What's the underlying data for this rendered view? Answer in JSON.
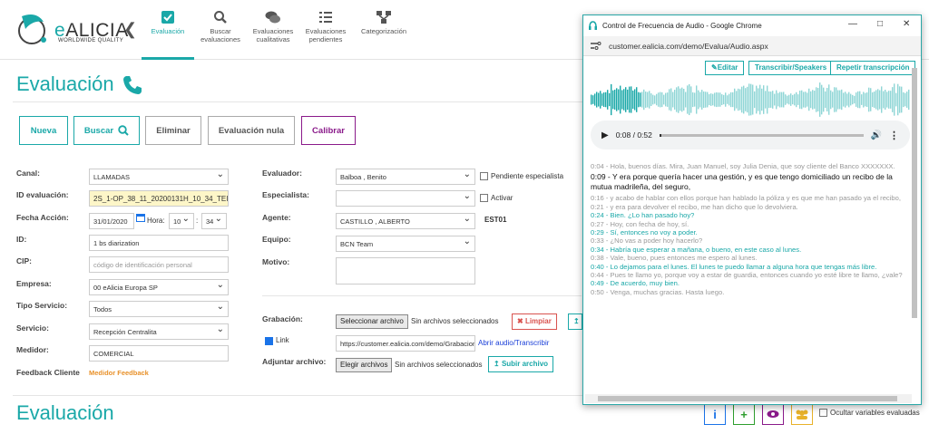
{
  "brand": {
    "name_e": "e",
    "name_rest": "ALICIA",
    "sub": "WORLDWIDE QUALITY"
  },
  "nav": [
    {
      "label": "Evaluación",
      "icon": "checkbox-icon"
    },
    {
      "label": "Buscar evaluaciones",
      "icon": "search-icon"
    },
    {
      "label": "Evaluaciones cualitativas",
      "icon": "comments-icon"
    },
    {
      "label": "Evaluaciones pendientes",
      "icon": "list-icon"
    },
    {
      "label": "Categorización",
      "icon": "sitemap-icon"
    }
  ],
  "page": {
    "title": "Evaluación",
    "bottom_title": "Evaluación"
  },
  "actions": {
    "nueva": "Nueva",
    "buscar": "Buscar",
    "eliminar": "Eliminar",
    "nula": "Evaluación nula",
    "calibrar": "Calibrar"
  },
  "form": {
    "canal_label": "Canal:",
    "canal": "LLAMADAS",
    "id_label": "ID evaluación:",
    "id": "2S_1-OP_38_11_20200131H_10_34_TEI",
    "fecha_label": "Fecha Acción:",
    "fecha": "31/01/2020",
    "hora_label": "Hora:",
    "hora": "10",
    "minuto": "34",
    "idf_label": "ID:",
    "idf": "1 bs diarization",
    "cip_label": "CIP:",
    "cip_placeholder": "código de identificación personal",
    "empresa_label": "Empresa:",
    "empresa": "00 eAlicia Europa SP",
    "tipo_label": "Tipo Servicio:",
    "tipo": "Todos",
    "servicio_label": "Servicio:",
    "servicio": "Recepción Centralita",
    "medidor_label": "Medidor:",
    "medidor": "COMERCIAL",
    "feedback_label": "Feedback Cliente",
    "feedback": "Medidor Feedback",
    "evaluador_label": "Evaluador:",
    "evaluador": "Balboa , Benito",
    "pendiente": "Pendiente especialista",
    "especialista_label": "Especialista:",
    "activar": "Activar",
    "agente_label": "Agente:",
    "agente": "CASTILLO , ALBERTO",
    "agente_code": "EST01",
    "equipo_label": "Equipo:",
    "equipo": "BCN Team",
    "motivo_label": "Motivo:",
    "grabacion_label": "Grabación:",
    "seleccionar": "Seleccionar archivo",
    "sin_archivos": "Sin archivos seleccionados",
    "limpiar": "Limpiar",
    "link_label": "Link",
    "link": "https://customer.ealicia.com/demo/Grabacion",
    "abrir": "Abrir audio/Transcribir",
    "adjuntar_label": "Adjuntar archivo:",
    "elegir": "Elegir archivos",
    "sin_archivos2": "Sin archivos seleccionados",
    "subir": "Subir archivo"
  },
  "bottom": {
    "ocultar": "Ocultar variables evaluadas"
  },
  "popup": {
    "title": "Control de Frecuencia de Audio - Google Chrome",
    "url": "customer.ealicia.com/demo/Evalua/Audio.aspx",
    "editar": "Editar",
    "transcribir": "Transcribir/Speakers",
    "repetir": "Repetir transcripción",
    "time": "0:08 / 0:52",
    "lines": [
      {
        "t": "0:04 - Hola, buenos días. Mira, Juan Manuel, soy Julia Denia, que soy cliente del Banco XXXXXXX.",
        "k": "tl"
      },
      {
        "t": "0:09 - Y era porque quería hacer una gestión, y es que tengo domiciliado un recibo de la mutua madrileña, del seguro,",
        "k": "tl cur"
      },
      {
        "t": "0:16 - y acabo de hablar con ellos porque han hablado la póliza y es que me han pasado ya el recibo,",
        "k": "tl"
      },
      {
        "t": "0:21 - y era para devolver el recibo, me han dicho que lo devolviera.",
        "k": "tl"
      },
      {
        "t": "0:24 - Bien. ¿Lo han pasado hoy?",
        "k": "tl spk"
      },
      {
        "t": "0:27 - Hoy, con fecha de hoy, sí.",
        "k": "tl"
      },
      {
        "t": "0:29 - Sí, entonces no voy a poder.",
        "k": "tl spk"
      },
      {
        "t": "0:33 - ¿No vas a poder hoy hacerlo?",
        "k": "tl"
      },
      {
        "t": "0:34 - Habría que esperar a mañana, o bueno, en este caso al lunes.",
        "k": "tl spk"
      },
      {
        "t": "0:38 - Vale, bueno, pues entonces me espero al lunes.",
        "k": "tl"
      },
      {
        "t": "0:40 - Lo dejamos para el lunes. El lunes te puedo llamar a alguna hora que tengas más libre.",
        "k": "tl spk"
      },
      {
        "t": "0:44 - Pues te llamo yo, porque voy a estar de guardia, entonces cuando yo esté libre te llamo, ¿vale?",
        "k": "tl"
      },
      {
        "t": "0:49 - De acuerdo, muy bien.",
        "k": "tl spk"
      },
      {
        "t": "0:50 - Venga, muchas gracias. Hasta luego.",
        "k": "tl"
      }
    ]
  },
  "colors": {
    "accent": "#1aa8a8",
    "purple": "#8a1a8a",
    "red": "#d9534f",
    "orange": "#e8912a"
  }
}
